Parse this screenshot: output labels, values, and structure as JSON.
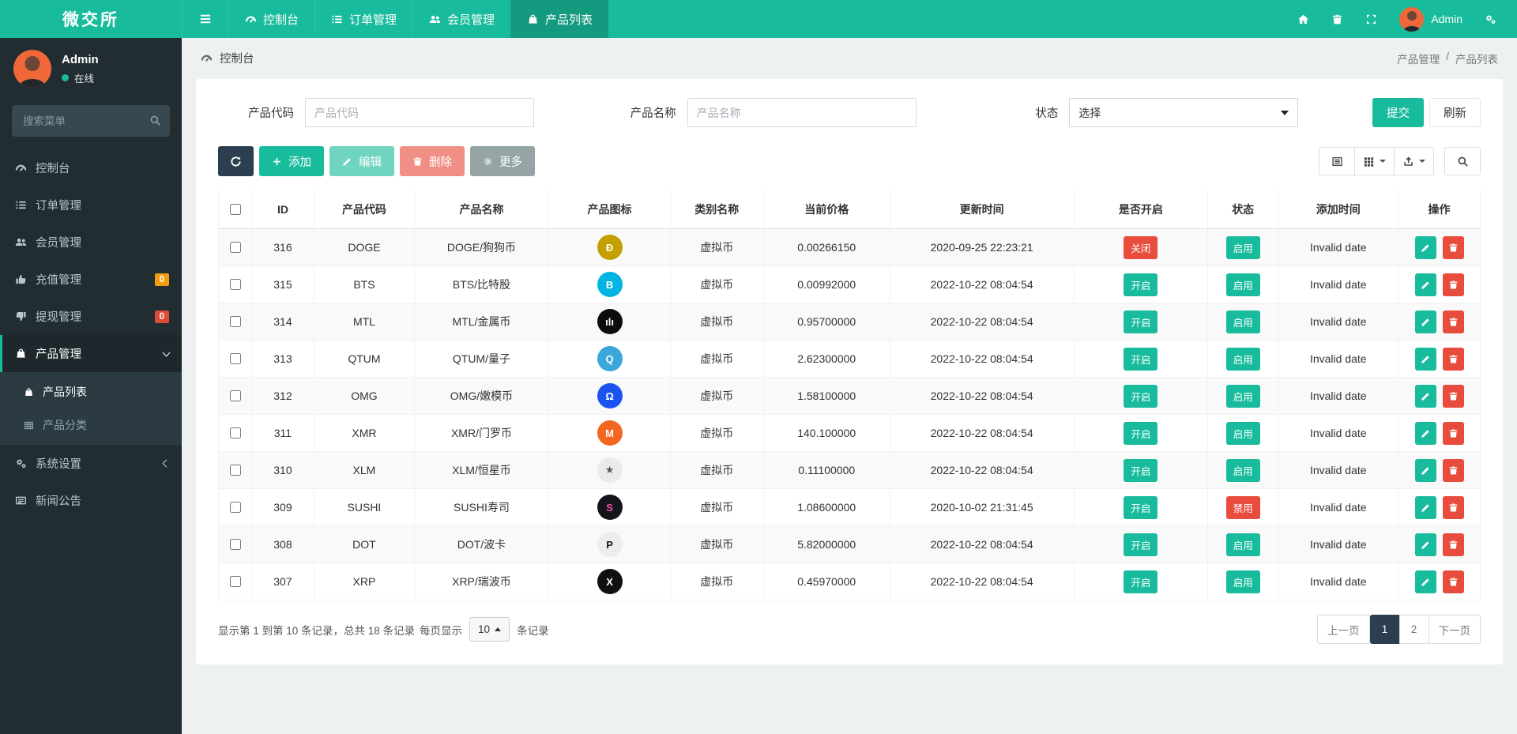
{
  "brand": "微交所",
  "colors": {
    "accent": "#18bc9c",
    "dark": "#2c3e50",
    "danger": "#e74c3c",
    "warning": "#f39c12",
    "sidebar": "#222d32"
  },
  "topnav": {
    "items": [
      {
        "label": "控制台"
      },
      {
        "label": "订单管理"
      },
      {
        "label": "会员管理"
      },
      {
        "label": "产品列表",
        "active": true
      }
    ],
    "user": "Admin"
  },
  "sidebar": {
    "user": {
      "name": "Admin",
      "status": "在线"
    },
    "search_placeholder": "搜索菜单",
    "items": [
      {
        "label": "控制台"
      },
      {
        "label": "订单管理"
      },
      {
        "label": "会员管理"
      },
      {
        "label": "充值管理",
        "badge": "0"
      },
      {
        "label": "提现管理",
        "badge": "0"
      },
      {
        "label": "产品管理",
        "children": [
          {
            "label": "产品列表"
          },
          {
            "label": "产品分类"
          }
        ]
      },
      {
        "label": "系统设置"
      },
      {
        "label": "新闻公告"
      }
    ]
  },
  "breadcrumb": {
    "section": "控制台",
    "parent": "产品管理",
    "sep": "/",
    "current": "产品列表"
  },
  "filters": {
    "code": {
      "label": "产品代码",
      "placeholder": "产品代码"
    },
    "name": {
      "label": "产品名称",
      "placeholder": "产品名称"
    },
    "status": {
      "label": "状态",
      "value": "选择"
    },
    "submit": "提交",
    "refresh": "刷新"
  },
  "toolbar": {
    "add": "添加",
    "edit": "编辑",
    "delete": "删除",
    "more": "更多"
  },
  "table": {
    "columns": [
      "ID",
      "产品代码",
      "产品名称",
      "产品图标",
      "类别名称",
      "当前价格",
      "更新时间",
      "是否开启",
      "状态",
      "添加时间",
      "操作"
    ],
    "rows": [
      {
        "id": "316",
        "code": "DOGE",
        "name": "DOGE/狗狗币",
        "icon": {
          "bg": "#c3a000",
          "fg": "#ffffff",
          "glyph": "Ð"
        },
        "category": "虚拟币",
        "price": "0.00266150",
        "updated": "2020-09-25 22:23:21",
        "open": {
          "label": "关闭",
          "type": "red"
        },
        "status": {
          "label": "启用",
          "type": "green"
        },
        "added": "Invalid date"
      },
      {
        "id": "315",
        "code": "BTS",
        "name": "BTS/比特股",
        "icon": {
          "bg": "#00b4e4",
          "fg": "#ffffff",
          "glyph": "B"
        },
        "category": "虚拟币",
        "price": "0.00992000",
        "updated": "2022-10-22 08:04:54",
        "open": {
          "label": "开启",
          "type": "green"
        },
        "status": {
          "label": "启用",
          "type": "green"
        },
        "added": "Invalid date"
      },
      {
        "id": "314",
        "code": "MTL",
        "name": "MTL/金属币",
        "icon": {
          "bg": "#0d0d0d",
          "fg": "#ffffff",
          "glyph": "ılı"
        },
        "category": "虚拟币",
        "price": "0.95700000",
        "updated": "2022-10-22 08:04:54",
        "open": {
          "label": "开启",
          "type": "green"
        },
        "status": {
          "label": "启用",
          "type": "green"
        },
        "added": "Invalid date"
      },
      {
        "id": "313",
        "code": "QTUM",
        "name": "QTUM/量子",
        "icon": {
          "bg": "#3aa6d9",
          "fg": "#ffffff",
          "glyph": "Q"
        },
        "category": "虚拟币",
        "price": "2.62300000",
        "updated": "2022-10-22 08:04:54",
        "open": {
          "label": "开启",
          "type": "green"
        },
        "status": {
          "label": "启用",
          "type": "green"
        },
        "added": "Invalid date"
      },
      {
        "id": "312",
        "code": "OMG",
        "name": "OMG/嫩模币",
        "icon": {
          "bg": "#1a53f0",
          "fg": "#ffffff",
          "glyph": "Ω"
        },
        "category": "虚拟币",
        "price": "1.58100000",
        "updated": "2022-10-22 08:04:54",
        "open": {
          "label": "开启",
          "type": "green"
        },
        "status": {
          "label": "启用",
          "type": "green"
        },
        "added": "Invalid date"
      },
      {
        "id": "311",
        "code": "XMR",
        "name": "XMR/门罗币",
        "icon": {
          "bg": "#f26822",
          "fg": "#ffffff",
          "glyph": "M"
        },
        "category": "虚拟币",
        "price": "140.100000",
        "updated": "2022-10-22 08:04:54",
        "open": {
          "label": "开启",
          "type": "green"
        },
        "status": {
          "label": "启用",
          "type": "green"
        },
        "added": "Invalid date"
      },
      {
        "id": "310",
        "code": "XLM",
        "name": "XLM/恒星币",
        "icon": {
          "bg": "#e9eaec",
          "fg": "#555555",
          "glyph": "★"
        },
        "category": "虚拟币",
        "price": "0.11100000",
        "updated": "2022-10-22 08:04:54",
        "open": {
          "label": "开启",
          "type": "green"
        },
        "status": {
          "label": "启用",
          "type": "green"
        },
        "added": "Invalid date"
      },
      {
        "id": "309",
        "code": "SUSHI",
        "name": "SUSHI寿司",
        "icon": {
          "bg": "#14151a",
          "fg": "#fa52a0",
          "glyph": "S"
        },
        "category": "虚拟币",
        "price": "1.08600000",
        "updated": "2020-10-02 21:31:45",
        "open": {
          "label": "开启",
          "type": "green"
        },
        "status": {
          "label": "禁用",
          "type": "red"
        },
        "added": "Invalid date"
      },
      {
        "id": "308",
        "code": "DOT",
        "name": "DOT/波卡",
        "icon": {
          "bg": "#ededed",
          "fg": "#1b1b1b",
          "glyph": "P"
        },
        "category": "虚拟币",
        "price": "5.82000000",
        "updated": "2022-10-22 08:04:54",
        "open": {
          "label": "开启",
          "type": "green"
        },
        "status": {
          "label": "启用",
          "type": "green"
        },
        "added": "Invalid date"
      },
      {
        "id": "307",
        "code": "XRP",
        "name": "XRP/瑞波币",
        "icon": {
          "bg": "#101010",
          "fg": "#ffffff",
          "glyph": "X"
        },
        "category": "虚拟币",
        "price": "0.45970000",
        "updated": "2022-10-22 08:04:54",
        "open": {
          "label": "开启",
          "type": "green"
        },
        "status": {
          "label": "启用",
          "type": "green"
        },
        "added": "Invalid date"
      }
    ]
  },
  "footer": {
    "summary": "显示第 1 到第 10 条记录，总共 18 条记录",
    "per_page_label": "每页显示",
    "per_page": "10",
    "per_page_suffix": "条记录",
    "pagination": {
      "prev": "上一页",
      "pages": [
        "1",
        "2"
      ],
      "active": "1",
      "next": "下一页"
    }
  }
}
